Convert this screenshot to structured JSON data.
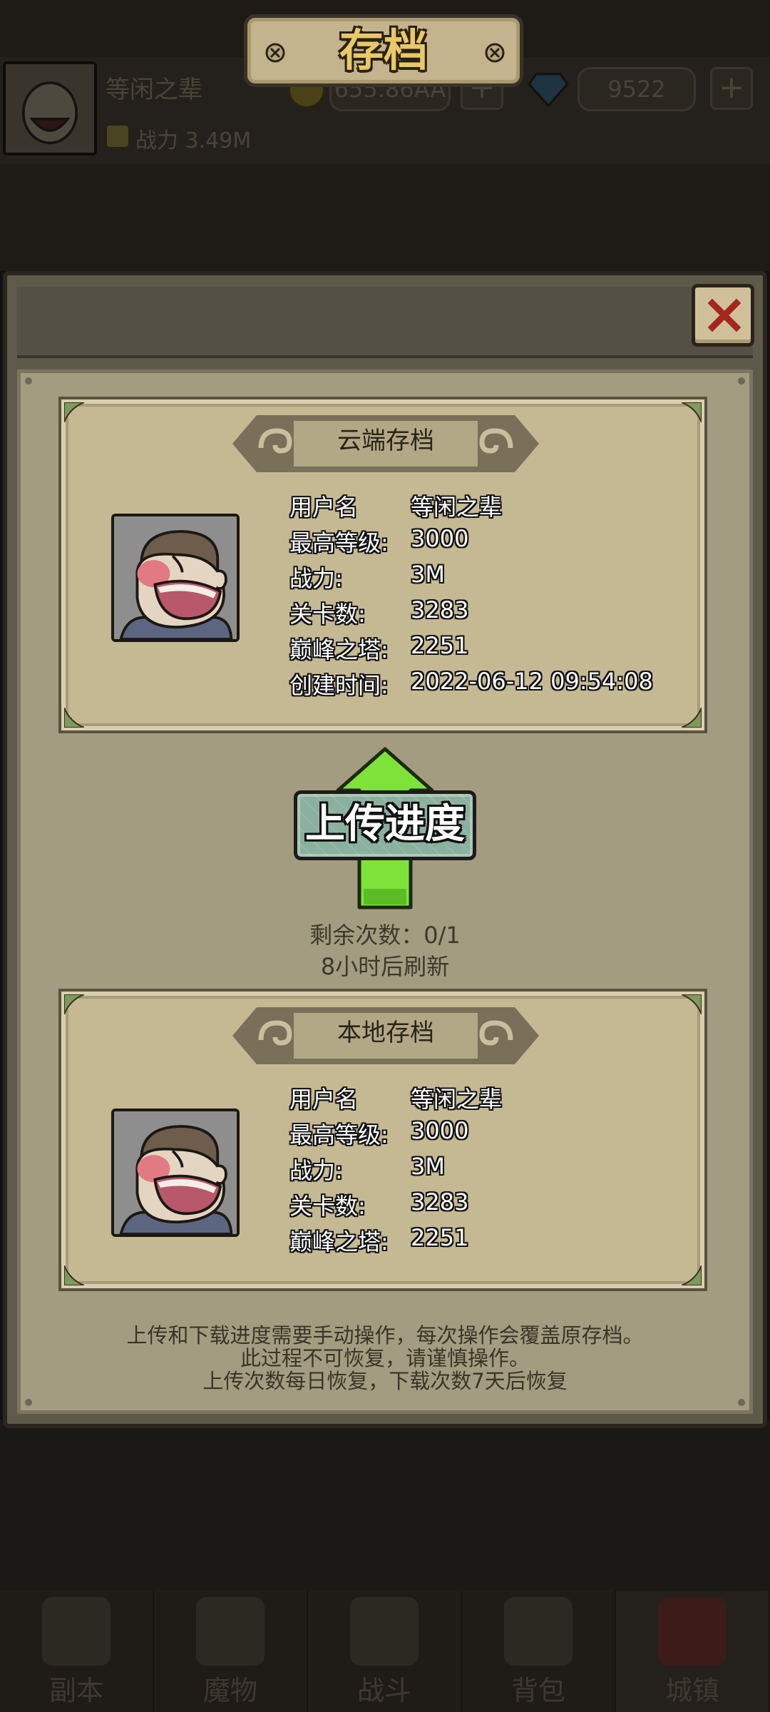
{
  "background_hud": {
    "player_name": "等闲之辈",
    "power_label": "战力",
    "power_value": "3.49M",
    "coins": "655.86AA",
    "gems": "9522",
    "plus": "+"
  },
  "bottom_nav": {
    "items": [
      {
        "label": "副本",
        "icon": "map-scroll-icon"
      },
      {
        "label": "魔物",
        "icon": "monster-icon"
      },
      {
        "label": "战斗",
        "icon": "crossed-swords-icon"
      },
      {
        "label": "背包",
        "icon": "backpack-icon"
      },
      {
        "label": "城镇",
        "icon": "castle-icon"
      }
    ],
    "active_index": 4
  },
  "modal": {
    "title": "存档",
    "close_icon": "close-icon"
  },
  "cloud_save": {
    "header": "云端存档",
    "rows": [
      {
        "label": "用户名",
        "value": "等闲之辈"
      },
      {
        "label": "最高等级:",
        "value": "3000"
      },
      {
        "label": "战力:",
        "value": "3M"
      },
      {
        "label": "关卡数:",
        "value": "3283"
      },
      {
        "label": "巅峰之塔:",
        "value": "2251"
      },
      {
        "label": "创建时间:",
        "value": "2022-06-12 09:54:08"
      }
    ]
  },
  "upload": {
    "button_label": "上传进度",
    "arrow_icon": "upload-arrow-icon",
    "remaining": "剩余次数：0/1",
    "refresh": "8小时后刷新"
  },
  "local_save": {
    "header": "本地存档",
    "rows": [
      {
        "label": "用户名",
        "value": "等闲之辈"
      },
      {
        "label": "最高等级:",
        "value": "3000"
      },
      {
        "label": "战力:",
        "value": "3M"
      },
      {
        "label": "关卡数:",
        "value": "3283"
      },
      {
        "label": "巅峰之塔:",
        "value": "2251"
      }
    ]
  },
  "footer_notes": [
    "上传和下载进度需要手动操作，每次操作会覆盖原存档。",
    "此过程不可恢复，请谨慎操作。",
    "上传次数每日恢复，下载次数7天后恢复"
  ],
  "colors": {
    "accent_green": "#7fe23a",
    "title_gold": "#e8c868",
    "close_red": "#a4261e",
    "card_bg": "#c5b994"
  }
}
